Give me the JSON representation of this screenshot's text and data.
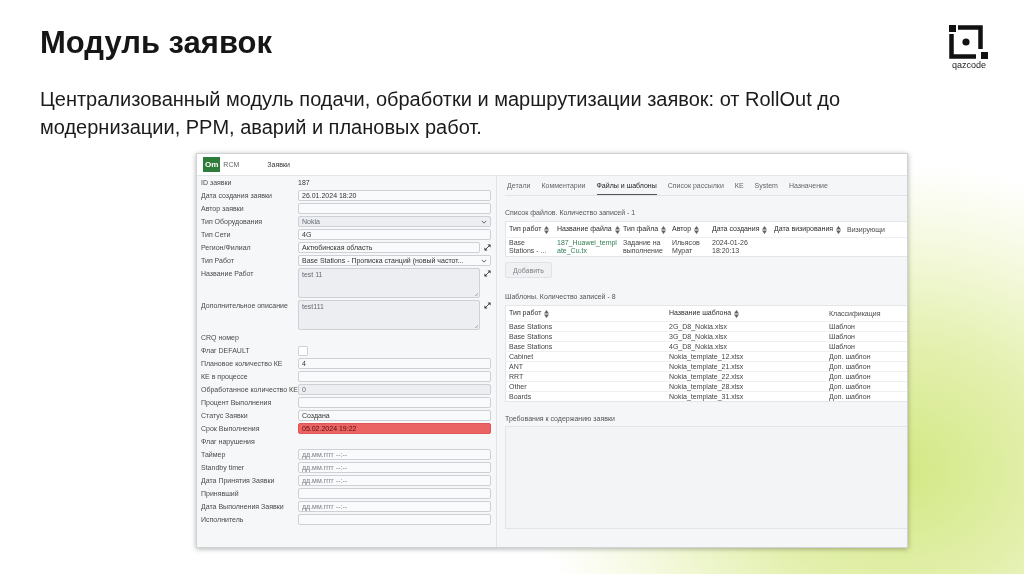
{
  "slide": {
    "title": "Модуль заявок",
    "subtitle": "Централизованный модуль подачи, обработки и маршрутизации заявок: от RollOut до модернизации, PPM, аварий и плановых работ.",
    "logo_text": "qazcode"
  },
  "app": {
    "brand": {
      "mark": "Om",
      "name": "RCM"
    },
    "nav": [
      {
        "label": "Заявки"
      }
    ],
    "form": [
      {
        "label": "ID заявки",
        "kind": "static",
        "value": "187"
      },
      {
        "label": "Дата создания заявки",
        "kind": "input",
        "value": "26.01.2024 18:20",
        "disabled": false,
        "error": false,
        "expandable": false
      },
      {
        "label": "Автор заявки",
        "kind": "input",
        "disabled": false,
        "error": false,
        "expandable": false
      },
      {
        "label": "Тип Оборудования",
        "kind": "select",
        "value": "Nokia",
        "disabled": true,
        "error": false,
        "expandable": false
      },
      {
        "label": "Тип Сети",
        "kind": "input",
        "value": "4G",
        "disabled": false,
        "error": false,
        "expandable": false
      },
      {
        "label": "Регион/Филиал",
        "kind": "input",
        "value": "Актюбинская область",
        "disabled": false,
        "error": false,
        "expandable": true
      },
      {
        "label": "Тип Работ",
        "kind": "select",
        "value": "Base Stations - Прописка станций (новый частот...",
        "disabled": false,
        "error": false,
        "expandable": false
      },
      {
        "label": "Название Работ",
        "kind": "textarea",
        "value": "test 11",
        "disabled": true,
        "error": false,
        "expandable": true
      },
      {
        "label": "Дополнительное описание",
        "kind": "textarea",
        "value": "test111",
        "disabled": true,
        "error": false,
        "expandable": true
      },
      {
        "label": "CRQ номер",
        "kind": "none"
      },
      {
        "label": "Флаг DEFAULT",
        "kind": "checkbox",
        "checked": false
      },
      {
        "label": "Плановое количество КЕ",
        "kind": "input",
        "value": "4",
        "disabled": false,
        "error": false,
        "expandable": false
      },
      {
        "label": "КЕ в процессе",
        "kind": "input",
        "disabled": false,
        "error": false,
        "expandable": false
      },
      {
        "label": "Обработанное количество КЕ",
        "kind": "input",
        "value": "0",
        "disabled": true,
        "error": false,
        "expandable": false
      },
      {
        "label": "Процент Выполнения",
        "kind": "input",
        "disabled": false,
        "error": false,
        "expandable": false
      },
      {
        "label": "Статус Заявки",
        "kind": "input",
        "value": "Создана",
        "disabled": false,
        "error": false,
        "expandable": false
      },
      {
        "label": "Срок Выполнения",
        "kind": "input",
        "value": "05.02.2024 19:22",
        "disabled": false,
        "error": true,
        "expandable": false
      },
      {
        "label": "Флаг нарушения",
        "kind": "none"
      },
      {
        "label": "Таймер",
        "kind": "input",
        "placeholder": "дд.мм.гггг --:--",
        "disabled": false,
        "error": false,
        "expandable": false
      },
      {
        "label": "Standby timer",
        "kind": "input",
        "placeholder": "дд.мм.гггг --:--",
        "disabled": false,
        "error": false,
        "expandable": false
      },
      {
        "label": "Дата Принятия Заявки",
        "kind": "input",
        "placeholder": "дд.мм.гггг --:--",
        "disabled": false,
        "error": false,
        "expandable": false
      },
      {
        "label": "Принявший",
        "kind": "input",
        "disabled": false,
        "error": false,
        "expandable": false
      },
      {
        "label": "Дата Выполнения Заявки",
        "kind": "input",
        "placeholder": "дд.мм.гггг --:--",
        "disabled": false,
        "error": false,
        "expandable": false
      },
      {
        "label": "Исполнитель",
        "kind": "input",
        "disabled": false,
        "error": false,
        "expandable": false
      }
    ],
    "tabs": [
      {
        "label": "Детали",
        "selected": false
      },
      {
        "label": "Комментарии",
        "selected": false
      },
      {
        "label": "Файлы и шаблоны",
        "selected": true
      },
      {
        "label": "Список рассылки",
        "selected": false
      },
      {
        "label": "КЕ",
        "selected": false
      },
      {
        "label": "System",
        "selected": false
      },
      {
        "label": "Назначение",
        "selected": false
      }
    ],
    "files": {
      "caption": "Список файлов. Количество записей - 1",
      "columns": [
        {
          "label": "Тип работ",
          "sortable": true
        },
        {
          "label": "Название файла",
          "sortable": true
        },
        {
          "label": "Тип файла",
          "sortable": true
        },
        {
          "label": "Автор",
          "sortable": true
        },
        {
          "label": "Дата создания",
          "sortable": true
        },
        {
          "label": "Дата визирования",
          "sortable": true
        },
        {
          "label": "Визирующи",
          "sortable": false
        }
      ],
      "rows": [
        {
          "cells": [
            {
              "text": "Base Stations - ...",
              "kind": "text"
            },
            {
              "text": "187_Huawei_template_Cu.tx",
              "kind": "link"
            },
            {
              "text": "Задание на выполнение",
              "kind": "text"
            },
            {
              "text": "Ильясов Мурат",
              "kind": "text"
            },
            {
              "text": "2024-01-26 18:20:13",
              "kind": "text"
            }
          ]
        }
      ]
    },
    "add_button": {
      "label": "Добавить",
      "disabled": true
    },
    "templates": {
      "caption": "Шаблоны. Количество записей - 8",
      "columns": [
        {
          "label": "Тип работ",
          "sortable": true
        },
        {
          "label": "Название шаблона",
          "sortable": true
        },
        {
          "label": "Классификация",
          "sortable": false
        }
      ],
      "rows": [
        {
          "cells": [
            "Base Stations",
            "2G_D8_Nokia.xlsx",
            "Шаблон"
          ]
        },
        {
          "cells": [
            "Base Stations",
            "3G_D8_Nokia.xlsx",
            "Шаблон"
          ]
        },
        {
          "cells": [
            "Base Stations",
            "4G_D8_Nokia.xlsx",
            "Шаблон"
          ]
        },
        {
          "cells": [
            "Cabinet",
            "Nokia_template_12.xlsx",
            "Доп. шаблон"
          ]
        },
        {
          "cells": [
            "ANT",
            "Nokia_template_21.xlsx",
            "Доп. шаблон"
          ]
        },
        {
          "cells": [
            "RRT",
            "Nokia_template_22.xlsx",
            "Доп. шаблон"
          ]
        },
        {
          "cells": [
            "Other",
            "Nokia_template_28.xlsx",
            "Доп. шаблон"
          ]
        },
        {
          "cells": [
            "Boards",
            "Nokia_template_31.xlsx",
            "Доп. шаблон"
          ]
        }
      ]
    },
    "requirements": {
      "label": "Требования к содержанию заявки"
    }
  }
}
